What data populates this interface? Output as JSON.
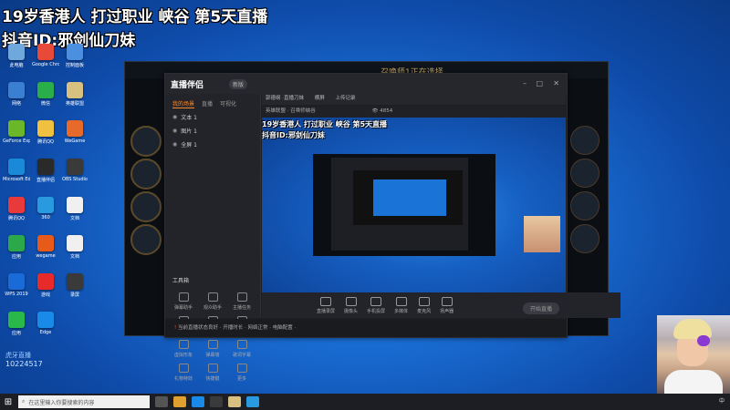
{
  "overlay": {
    "title_line1": "19岁香港人 打过职业 峡谷 第5天直播",
    "title_line2": "抖音ID:邪剑仙刀妹"
  },
  "desktop_icons": [
    {
      "label": "此电脑",
      "color": "#6fa8dc",
      "icon": "computer-icon"
    },
    {
      "label": "Google Chrome",
      "color": "#e84a3a",
      "icon": "chrome-icon"
    },
    {
      "label": "控制面板",
      "color": "#4a8fe0",
      "icon": "control-panel-icon"
    },
    {
      "label": "网络",
      "color": "#3a7fd0",
      "icon": "network-icon"
    },
    {
      "label": "微信",
      "color": "#2aae4a",
      "icon": "wechat-icon"
    },
    {
      "label": "英雄联盟",
      "color": "#d8c080",
      "icon": "lol-icon"
    },
    {
      "label": "GeForce Experience",
      "color": "#6ab82a",
      "icon": "geforce-icon"
    },
    {
      "label": "腾讯QQ",
      "color": "#f0c040",
      "icon": "folder-icon"
    },
    {
      "label": "WeGame",
      "color": "#e86a2a",
      "icon": "wegame-icon"
    },
    {
      "label": "Microsoft Edge",
      "color": "#1a8ad8",
      "icon": "app-icon"
    },
    {
      "label": "直播伴侣",
      "color": "#2a2a2a",
      "icon": "live-icon"
    },
    {
      "label": "OBS Studio",
      "color": "#3a3a3a",
      "icon": "obs-icon"
    },
    {
      "label": "腾讯QQ",
      "color": "#e83a3a",
      "icon": "qq-icon"
    },
    {
      "label": "360",
      "color": "#2a9ae0",
      "icon": "360-icon"
    },
    {
      "label": "文档",
      "color": "#f0f0f0",
      "icon": "doc-icon"
    },
    {
      "label": "应用",
      "color": "#2aa84a",
      "icon": "app2-icon"
    },
    {
      "label": "wegame",
      "color": "#e85a1a",
      "icon": "game-icon"
    },
    {
      "label": "文档",
      "color": "#f0f0f0",
      "icon": "doc2-icon"
    },
    {
      "label": "WPS 2019",
      "color": "#1a6ad8",
      "icon": "wps-icon"
    },
    {
      "label": "游戏",
      "color": "#e82a2a",
      "icon": "game2-icon"
    },
    {
      "label": "录屏",
      "color": "#3a3a3a",
      "icon": "record-icon"
    },
    {
      "label": "应用",
      "color": "#2ab84a",
      "icon": "app3-icon"
    },
    {
      "label": "Edge",
      "color": "#1a8ae8",
      "icon": "edge-icon"
    }
  ],
  "game_window": {
    "title": "召唤师1正在选择"
  },
  "stream_app": {
    "logo": "直播伴侣",
    "version": "新版",
    "tabs": [
      "我的场景",
      "直播",
      "可视化"
    ],
    "scenes": [
      {
        "label": "文本 1"
      },
      {
        "label": "图片 1"
      },
      {
        "label": "全屏 1"
      }
    ],
    "tools_title": "工具箱",
    "tools": [
      "弹幕助手",
      "观众助手",
      "主播任务",
      "粉丝活动",
      "多人连线",
      "成就录",
      "虚拟形象",
      "弹幕墙",
      "歌词字幕",
      "礼物特效",
      "快捷键",
      "更多"
    ],
    "preview_bar": "郭德纲 ·直播刀妹",
    "preview_btn1": "横屏",
    "preview_btn2": "上传记录",
    "preview2": "英雄联盟 · 召唤师峡谷",
    "viewer_count": "4854",
    "bottom_buttons": [
      "直播录屏",
      "摄像头",
      "手机投屏",
      "多媒体",
      "麦克风",
      "扬声器"
    ],
    "golive": "开始直播",
    "status_text": "当前直播状态良好 · 开播时长 · 网络正常 · 电脑配置 ·",
    "status_warn": "!"
  },
  "watermark": {
    "name": "虎牙直播",
    "id": "10224517"
  },
  "taskbar": {
    "search_placeholder": "在这里输入你要搜索的内容",
    "tray_text": "中"
  }
}
